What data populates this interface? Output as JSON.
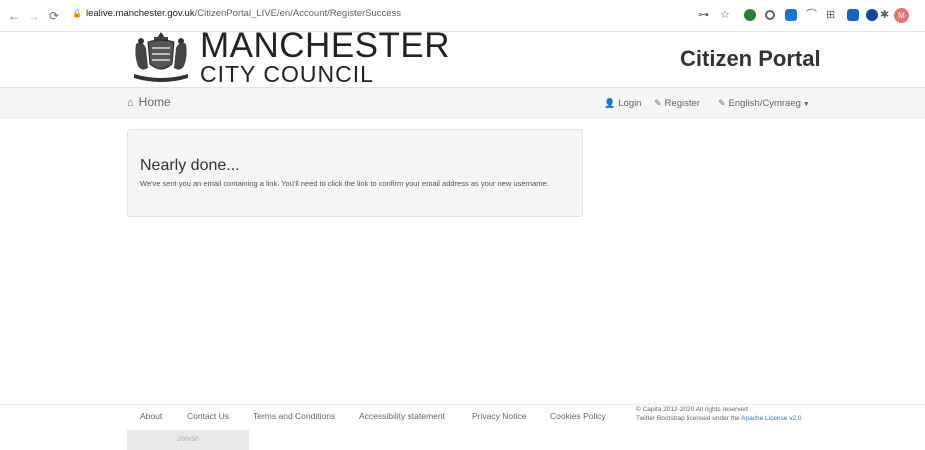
{
  "browser": {
    "back_icon": "back-arrow-icon",
    "forward_icon": "forward-arrow-icon",
    "reload_icon": "reload-icon",
    "url_host": "lealive.manchester.gov.uk",
    "url_path": "/CitizenPortal_LIVE/en/Account/RegisterSuccess",
    "profile_initial": "M"
  },
  "header": {
    "brand_line1": "MANCHESTER",
    "brand_line2": "CITY COUNCIL",
    "portal_title": "Citizen Portal"
  },
  "navbar": {
    "home_label": "Home",
    "login_label": "Login",
    "register_label": "Register",
    "language_label": "English/Cymraeg"
  },
  "panel": {
    "heading": "Nearly done...",
    "message": "We've sent you an email containing a link. You'll need to click the link to confirm your email address as your new username."
  },
  "footer": {
    "links": [
      "About",
      "Contact Us",
      "Terms and Conditions",
      "Accessibility statement",
      "Privacy Notice",
      "Cookies Policy"
    ],
    "copyright": "© Capita 2012-2020 All rights reserved",
    "bootstrap_text": "Twitter Bootstrap licensed under the",
    "license_link": "Apache License v2.0",
    "placeholder_text": "200x50"
  },
  "colors": {
    "link": "#337ab7",
    "navbar_bg": "#f5f5f5",
    "panel_bg": "#f5f5f5",
    "text": "#333333"
  }
}
